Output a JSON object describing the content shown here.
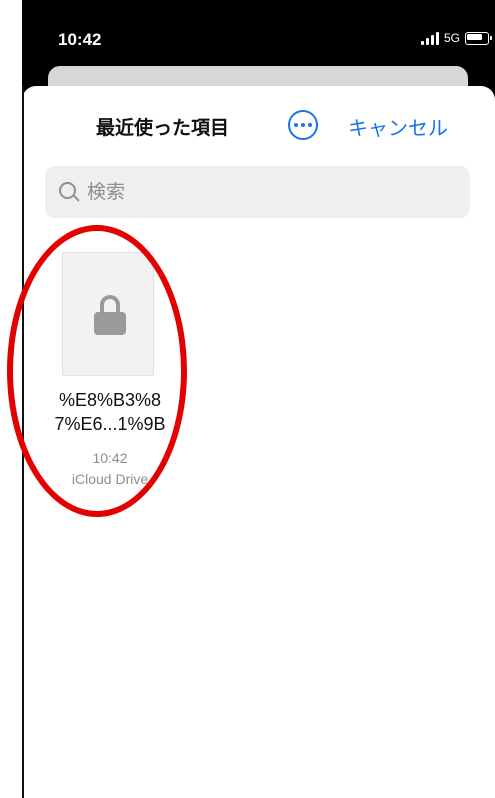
{
  "status_bar": {
    "time": "10:42",
    "network": "5G"
  },
  "header": {
    "title": "最近使った項目",
    "cancel_label": "キャンセル"
  },
  "search": {
    "placeholder": "検索"
  },
  "files": [
    {
      "name_line1": "%E8%B3%8",
      "name_line2": "7%E6...1%9B",
      "time": "10:42",
      "location": "iCloud Drive"
    }
  ],
  "colors": {
    "accent": "#1a73e8",
    "annotation": "#e40000"
  },
  "icons": [
    "search-icon",
    "more-icon",
    "lock-icon",
    "battery-icon",
    "signal-icon"
  ]
}
